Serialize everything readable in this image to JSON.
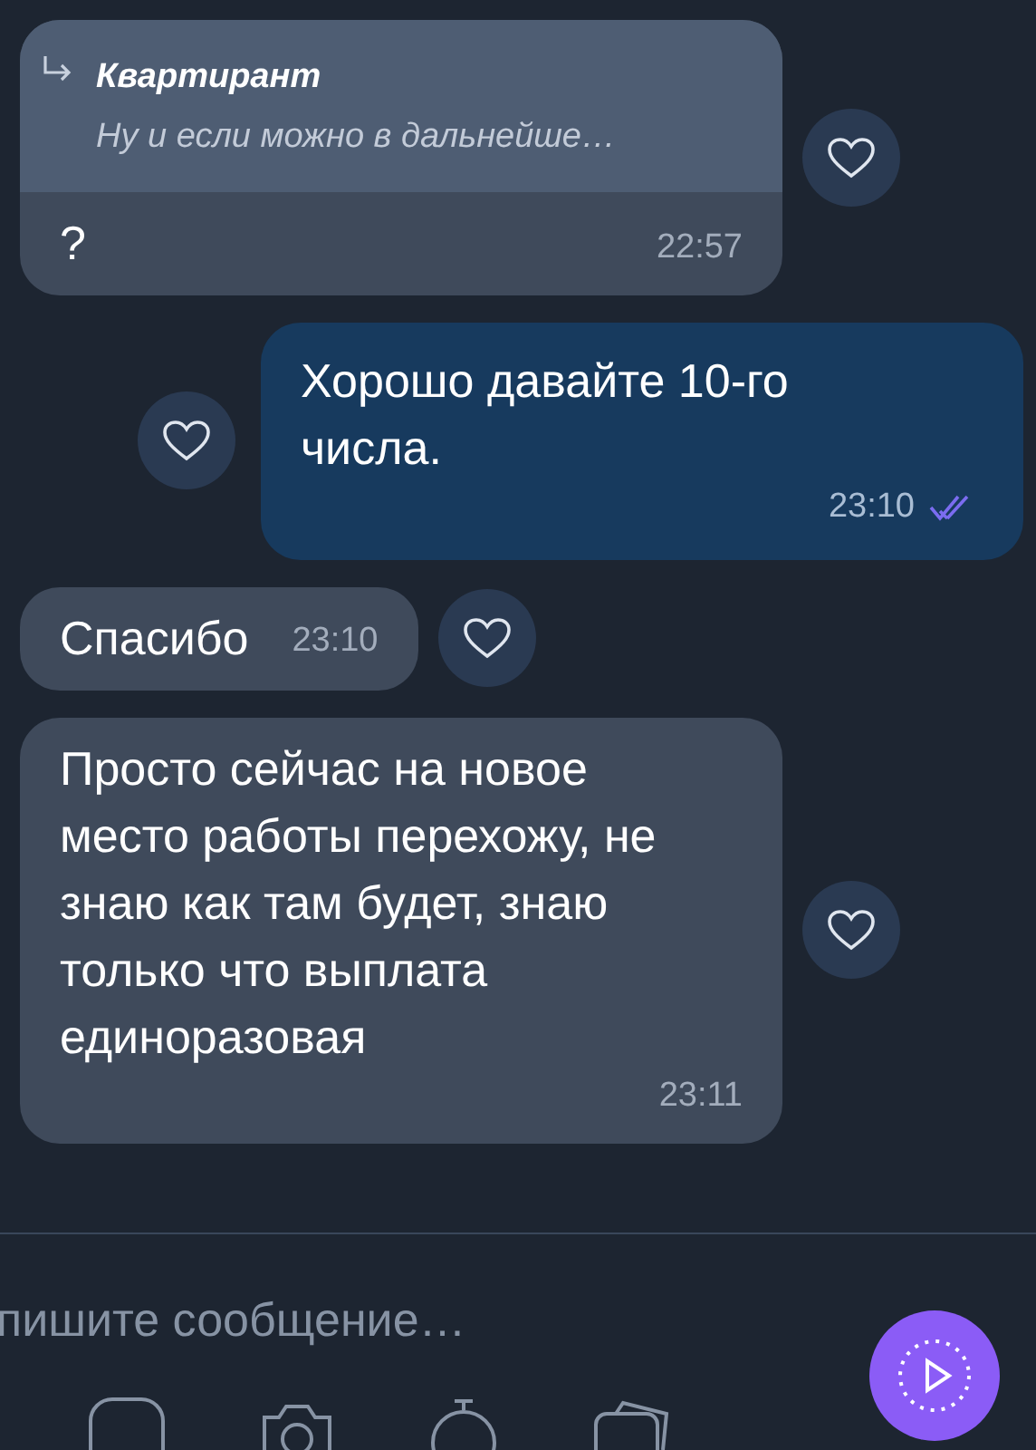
{
  "messages": [
    {
      "kind": "incoming",
      "reply": {
        "author": "Квартирант",
        "text": "Ну и если можно в дальнейше…"
      },
      "text": "?",
      "time": "22:57",
      "liked": false
    },
    {
      "kind": "outgoing",
      "text": "Хорошо давайте 10-го числа.",
      "time": "23:10",
      "read": true,
      "liked": false
    },
    {
      "kind": "incoming",
      "text": "Спасибо",
      "time": "23:10",
      "liked": false
    },
    {
      "kind": "incoming",
      "text": "Просто сейчас на новое место работы перехожу, не знаю как там будет, знаю только что выплата единоразовая",
      "time": "23:11",
      "liked": false
    }
  ],
  "composer": {
    "placeholder": "пишите сообщение…"
  }
}
